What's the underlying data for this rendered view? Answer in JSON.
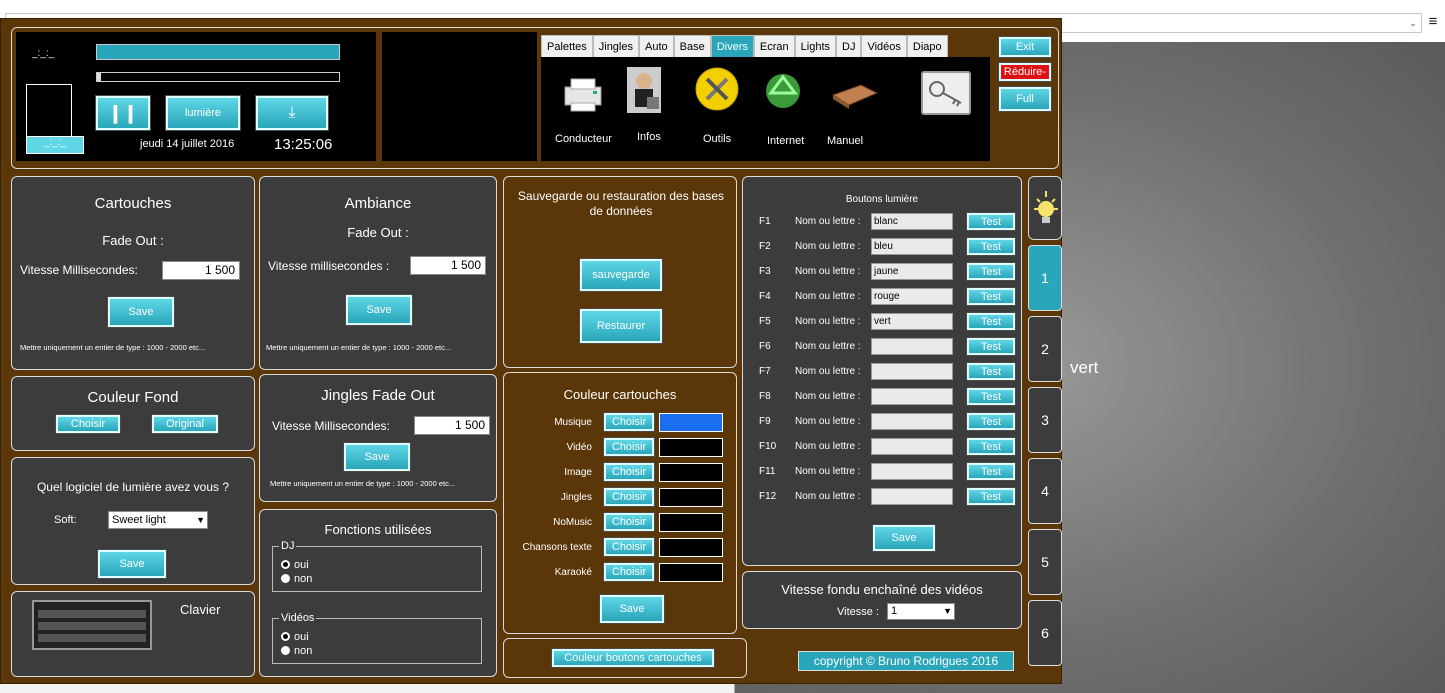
{
  "top": {
    "menu_icon": "hamburger-icon",
    "dropdown_icon": "chevron-down-icon"
  },
  "player": {
    "time_top": "_:_:_",
    "time_bottom": "_:_:_",
    "light_label": "lumière",
    "date": "jeudi 14 juillet 2016",
    "clock": "13:25:06"
  },
  "tabs": [
    "Palettes",
    "Jingles",
    "Auto",
    "Base",
    "Divers",
    "Ecran",
    "Lights",
    "DJ",
    "Vidéos",
    "Diapo"
  ],
  "active_tab": "Divers",
  "divers_icons": [
    {
      "label": "Conducteur",
      "icon": "printer-icon"
    },
    {
      "label": "Infos",
      "icon": "user-lock-icon"
    },
    {
      "label": "Outils",
      "icon": "tools-icon"
    },
    {
      "label": "Internet",
      "icon": "recycle-globe-icon"
    },
    {
      "label": "Manuel",
      "icon": "book-icon"
    },
    {
      "label": "",
      "icon": "key-icon"
    }
  ],
  "window_buttons": {
    "exit": "Exit",
    "reduce": "Réduire-",
    "full": "Full"
  },
  "cartouches": {
    "title": "Cartouches",
    "fade": "Fade Out :",
    "speed_label": "Vitesse Millisecondes:",
    "speed_value": "1 500",
    "save": "Save",
    "hint": "Mettre uniquement un entier de type : 1000 - 2000 etc..."
  },
  "ambiance": {
    "title": "Ambiance",
    "fade": "Fade Out :",
    "speed_label": "Vitesse millisecondes :",
    "speed_value": "1 500",
    "save": "Save",
    "hint": "Mettre uniquement un entier de type : 1000 - 2000 etc..."
  },
  "backup": {
    "title": "Sauvegarde ou restauration des bases de données",
    "save": "sauvegarde",
    "restore": "Restaurer"
  },
  "couleur_fond": {
    "title": "Couleur Fond",
    "choose": "Choisir",
    "original": "Original"
  },
  "jingles": {
    "title": "Jingles Fade Out",
    "speed_label": "Vitesse Millisecondes:",
    "speed_value": "1 500",
    "save": "Save",
    "hint": "Mettre uniquement un entier de type : 1000 - 2000 etc..."
  },
  "couleur_cartouches": {
    "title": "Couleur cartouches",
    "choose": "Choisir",
    "save": "Save",
    "rows": [
      {
        "label": "Musique",
        "color": "#1a6ff0"
      },
      {
        "label": "Vidéo",
        "color": "#000000"
      },
      {
        "label": "Image",
        "color": "#000000"
      },
      {
        "label": "Jingles",
        "color": "#000000"
      },
      {
        "label": "NoMusic",
        "color": "#000000"
      },
      {
        "label": "Chansons texte",
        "color": "#000000"
      },
      {
        "label": "Karaoké",
        "color": "#000000"
      }
    ]
  },
  "logiciel": {
    "title": "Quel logiciel de lumière avez vous ?",
    "soft_label": "Soft:",
    "soft_value": "Sweet light",
    "save": "Save"
  },
  "fonctions": {
    "title": "Fonctions utilisées",
    "dj": "DJ",
    "videos": "Vidéos",
    "oui": "oui",
    "non": "non"
  },
  "clavier": {
    "title": "Clavier"
  },
  "couleur_boutons": {
    "label": "Couleur boutons cartouches"
  },
  "boutons_lumiere": {
    "title": "Boutons lumière",
    "field_label": "Nom ou lettre :",
    "test": "Test",
    "save": "Save",
    "rows": [
      {
        "key": "F1",
        "value": "blanc"
      },
      {
        "key": "F2",
        "value": "bleu"
      },
      {
        "key": "F3",
        "value": "jaune"
      },
      {
        "key": "F4",
        "value": "rouge"
      },
      {
        "key": "F5",
        "value": "vert"
      },
      {
        "key": "F6",
        "value": ""
      },
      {
        "key": "F7",
        "value": ""
      },
      {
        "key": "F8",
        "value": ""
      },
      {
        "key": "F9",
        "value": ""
      },
      {
        "key": "F10",
        "value": ""
      },
      {
        "key": "F11",
        "value": ""
      },
      {
        "key": "F12",
        "value": ""
      }
    ]
  },
  "fondu": {
    "title": "Vitesse fondu enchaîné des vidéos",
    "speed_label": "Vitesse :",
    "speed_value": "1"
  },
  "copyright": "copyright © Bruno Rodrigues 2016",
  "side_numbers": [
    "1",
    "2",
    "3",
    "4",
    "5",
    "6"
  ],
  "side_icon": "lightbulb-icon",
  "overlay_text": "vert",
  "accent": "#2aa6ba",
  "frame": "#5b3608"
}
